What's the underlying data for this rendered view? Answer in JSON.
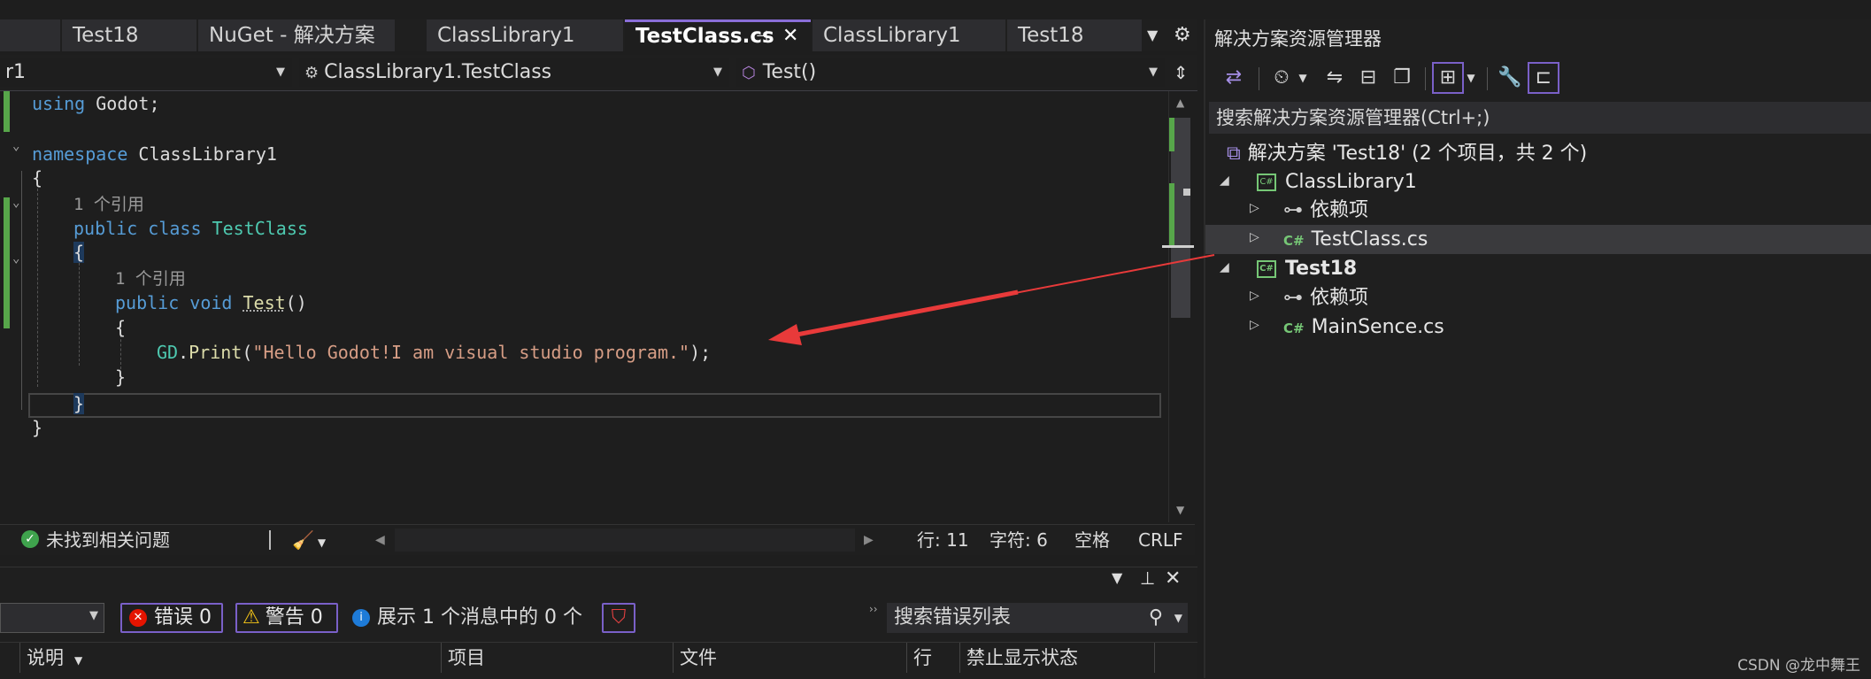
{
  "tabs": [
    {
      "label": "Test18"
    },
    {
      "label": "NuGet - 解决方案"
    },
    {
      "label": "ClassLibrary1"
    },
    {
      "label": "TestClass.cs"
    },
    {
      "label": "ClassLibrary1"
    },
    {
      "label": "Test18"
    }
  ],
  "navbar": {
    "project_fragment": "r1",
    "class_selector": "ClassLibrary1.TestClass",
    "member_selector": "Test()"
  },
  "code": {
    "line1": [
      "using",
      " Godot;"
    ],
    "line2": [
      "namespace",
      " ClassLibrary1"
    ],
    "brace_open": "{",
    "ref1": "1 个引用",
    "line_class": [
      "public class",
      " ",
      "TestClass"
    ],
    "brace_open2": "{",
    "ref2": "1 个引用",
    "line_method": [
      "public void",
      " ",
      "Test",
      "()"
    ],
    "brace_open3": "{",
    "line_print": [
      "GD",
      ".",
      "Print",
      "(",
      "\"Hello Godot!I am visual studio program.\"",
      ");"
    ],
    "brace_close3": "}",
    "brace_close2": "}",
    "brace_close1": "}"
  },
  "status": {
    "issues": "未找到相关问题",
    "line": "行: 11",
    "char": "字符: 6",
    "spaces": "空格",
    "eol": "CRLF"
  },
  "errorlist": {
    "errors": "错误 0",
    "warnings": "警告 0",
    "messages": "展示 1 个消息中的 0 个",
    "search_placeholder": "搜索错误列表",
    "columns": [
      "说明",
      "项目",
      "文件",
      "行",
      "禁止显示状态"
    ]
  },
  "solution": {
    "title": "解决方案资源管理器",
    "search_placeholder": "搜索解决方案资源管理器(Ctrl+;)",
    "root": "解决方案 'Test18' (2 个项目，共 2 个)",
    "items": [
      {
        "label": "ClassLibrary1"
      },
      {
        "label": "依赖项"
      },
      {
        "label": "TestClass.cs"
      },
      {
        "label": "Test18"
      },
      {
        "label": "依赖项"
      },
      {
        "label": "MainSence.cs"
      }
    ],
    "cs_badge": "C#"
  },
  "watermark": "CSDN @龙中舞王",
  "colors": {
    "accent": "#8a6ed8",
    "arrow": "#e83a3a",
    "git_added": "#57a64a"
  }
}
